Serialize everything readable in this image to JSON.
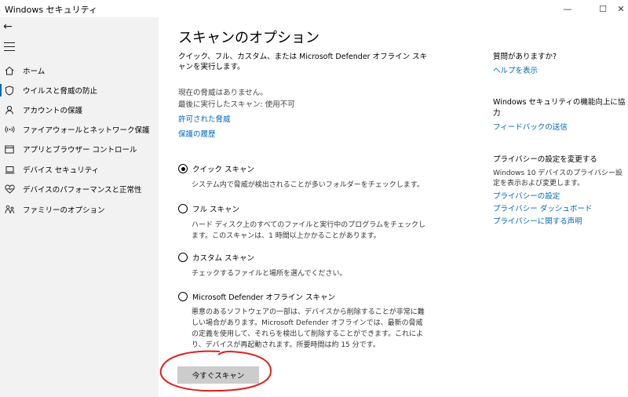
{
  "window": {
    "title": "Windows セキュリティ",
    "minimize": "—",
    "maximize": "☐",
    "close": "✕"
  },
  "sidebar": {
    "back": "←",
    "items": [
      {
        "label": "ホーム",
        "icon": "home-icon"
      },
      {
        "label": "ウイルスと脅威の防止",
        "icon": "shield-icon",
        "active": true
      },
      {
        "label": "アカウントの保護",
        "icon": "person-icon"
      },
      {
        "label": "ファイアウォールとネットワーク保護",
        "icon": "wifi-icon"
      },
      {
        "label": "アプリとブラウザー コントロール",
        "icon": "app-window-icon"
      },
      {
        "label": "デバイス セキュリティ",
        "icon": "laptop-icon"
      },
      {
        "label": "デバイスのパフォーマンスと正常性",
        "icon": "heart-icon"
      },
      {
        "label": "ファミリーのオプション",
        "icon": "family-icon"
      }
    ]
  },
  "main": {
    "title": "スキャンのオプション",
    "description": "クイック、フル、カスタム、または Microsoft Defender オフライン スキャンを実行します。",
    "status_threats": "現在の脅威はありません。",
    "status_last_scan": "最後に実行したスキャン: 使用不可",
    "link_allowed": "許可された脅威",
    "link_history": "保護の履歴",
    "options": [
      {
        "label": "クイック スキャン",
        "desc": "システム内で脅威が検出されることが多いフォルダーをチェックします。",
        "checked": true
      },
      {
        "label": "フル スキャン",
        "desc": "ハード ディスク上のすべてのファイルと実行中のプログラムをチェックします。このスキャンは、1 時間以上かかることがあります。",
        "checked": false
      },
      {
        "label": "カスタム スキャン",
        "desc": "チェックするファイルと場所を選んでください。",
        "checked": false
      },
      {
        "label": "Microsoft Defender オフライン スキャン",
        "desc": "悪意のあるソフトウェアの一部は、デバイスから削除することが非常に難しい場合があります。Microsoft Defender オフラインでは、最新の脅威の定義を使用して、それらを検出して削除することができます。これにより、デバイスが再起動されます。所要時間は約 15 分です。",
        "checked": false
      }
    ],
    "scan_button": "今すぐスキャン"
  },
  "right": {
    "help_heading": "質問がありますか?",
    "help_link": "ヘルプを表示",
    "improve_heading": "Windows セキュリティの機能向上に協力",
    "feedback_link": "フィードバックの送信",
    "privacy_heading": "プライバシーの設定を変更する",
    "privacy_text": "Windows 10 デバイスのプライバシー設定を表示および変更します。",
    "privacy_links": [
      "プライバシーの設定",
      "プライバシー ダッシュボード",
      "プライバシーに関する声明"
    ]
  },
  "colors": {
    "accent": "#0067c0",
    "annotation": "#e0201c",
    "sidebar_bg": "#f2f2f2",
    "button_bg": "#cccccc"
  }
}
